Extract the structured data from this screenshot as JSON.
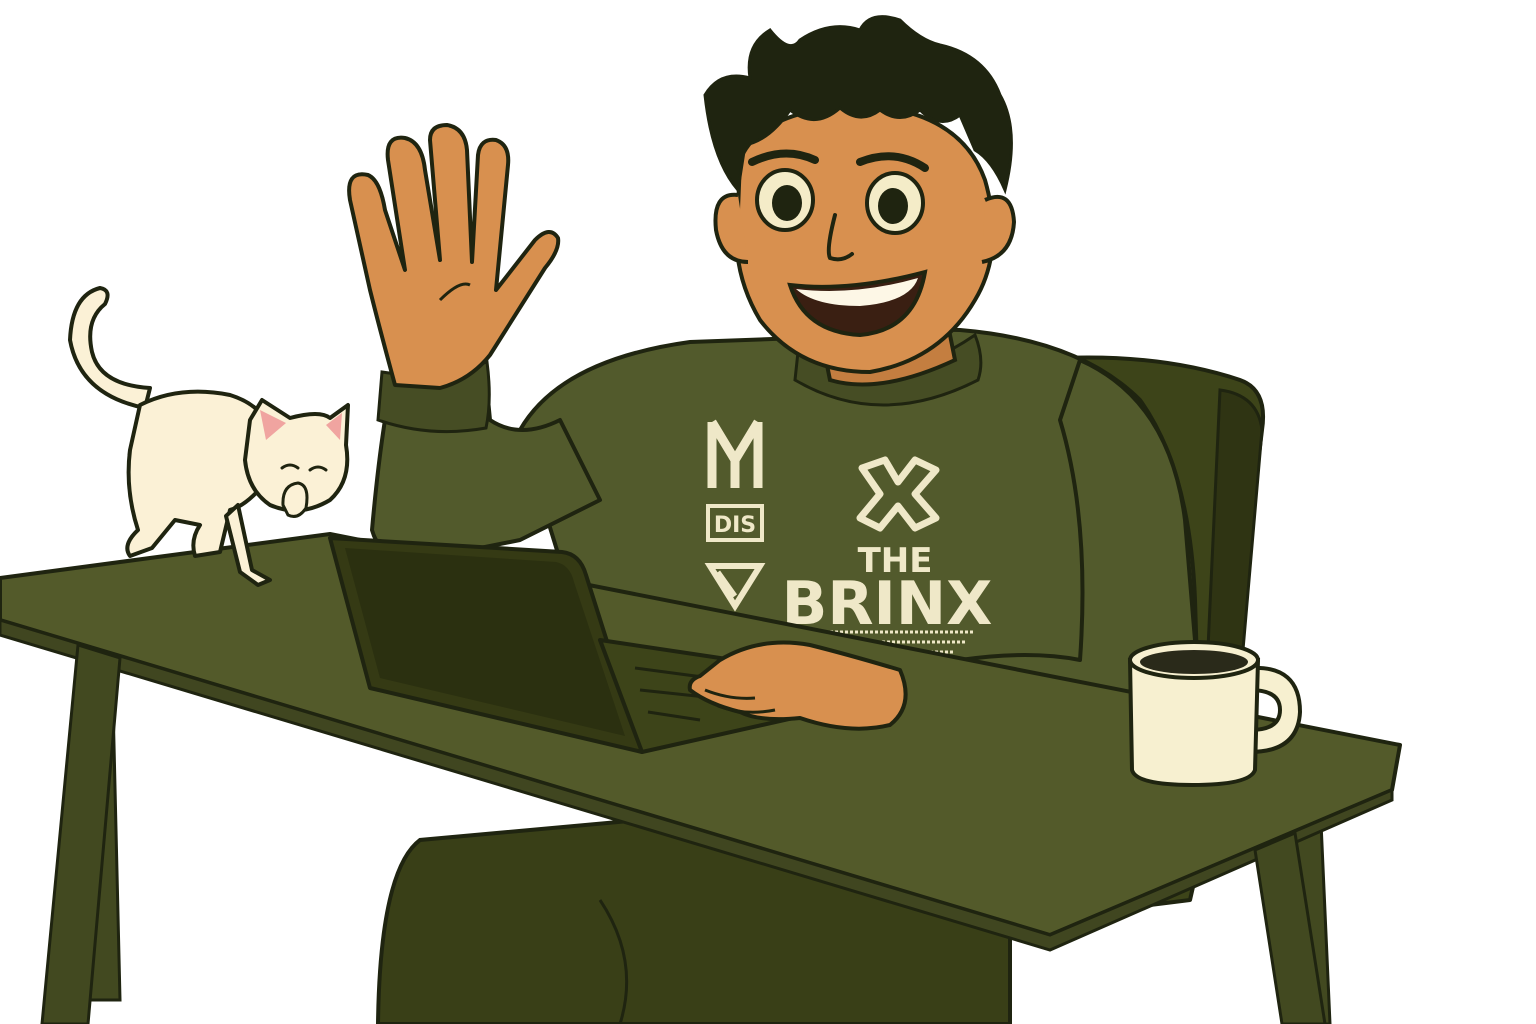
{
  "scene": {
    "description_label": "",
    "colors": {
      "background": "#ffffff",
      "outline": "#1f2410",
      "table_top": "#535a2a",
      "table_edge": "#404620",
      "table_legs": "#424920",
      "chair": "#3d4419",
      "chair_dark": "#2f3413",
      "sweater": "#525a2c",
      "sweater_shadow": "#464d24",
      "pants": "#393f17",
      "skin": "#d8904f",
      "skin_shadow": "#c47e40",
      "hair": "#1f2410",
      "laptop": "#353a14",
      "laptop_screen": "#2b3010",
      "cat": "#fbf1d6",
      "cat_ear_inner": "#f0a4a0",
      "mug": "#f7f0d0",
      "coffee": "#2a2a1a",
      "shirt_print": "#efe8c8",
      "eye_white": "#f4ecc8",
      "teeth": "#fdf7e6"
    },
    "shirt_print": {
      "line1": "THE",
      "line2": "BRINX",
      "badge": "DIS"
    },
    "icons": {
      "x_mark": "x-cross-icon",
      "triangle": "inverted-triangle-icon",
      "m_mark": "m-glyph-icon"
    }
  }
}
